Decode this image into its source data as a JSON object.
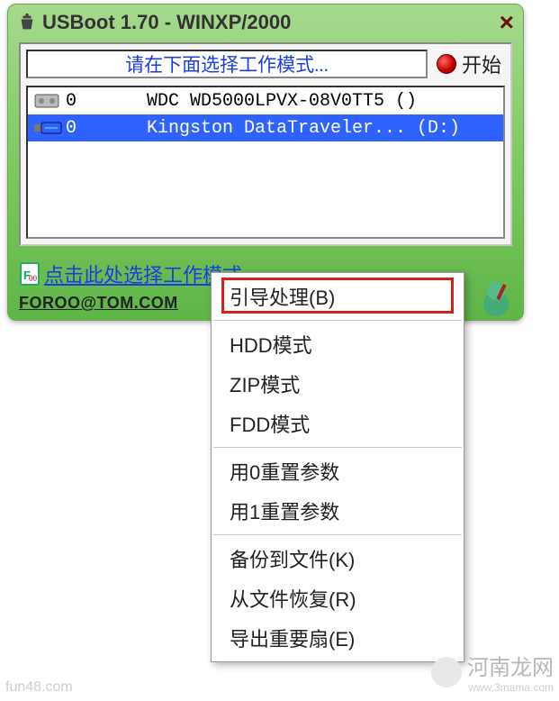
{
  "window": {
    "title": "USBoot 1.70 - WINXP/2000",
    "close_label": "×"
  },
  "panel": {
    "instruction": "请在下面选择工作模式...",
    "start_label": "开始"
  },
  "drives": [
    {
      "index": "0",
      "name": "WDC WD5000LPVX-08V0TT5 ()",
      "selected": false,
      "icon": "hdd"
    },
    {
      "index": "0",
      "name": "Kingston DataTraveler... (D:)",
      "selected": true,
      "icon": "usb"
    }
  ],
  "status": {
    "mode_link": "点击此处选择工作模式",
    "email": "FOROO@TOM.COM"
  },
  "menu": {
    "items": [
      "引导处理(B)",
      "HDD模式",
      "ZIP模式",
      "FDD模式",
      "用0重置参数",
      "用1重置参数",
      "备份到文件(K)",
      "从文件恢复(R)",
      "导出重要扇(E)"
    ],
    "separators_after": [
      0,
      3,
      5
    ]
  },
  "watermark": {
    "left": "fun48.com",
    "right_cn": "河南龙网",
    "right_url": "www.3mama.com"
  }
}
